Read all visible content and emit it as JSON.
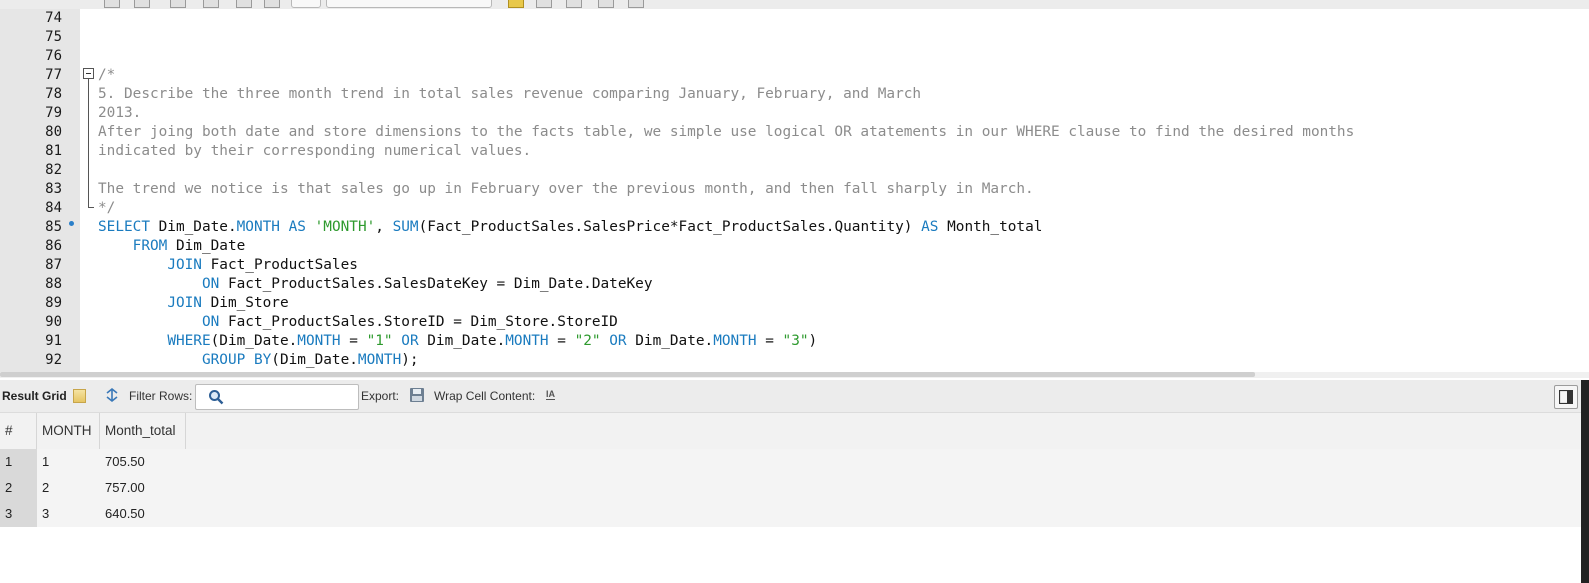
{
  "editor": {
    "lines": [
      {
        "num": "74",
        "segments": []
      },
      {
        "num": "75",
        "segments": []
      },
      {
        "num": "76",
        "segments": []
      },
      {
        "num": "77",
        "segments": [
          {
            "t": "cm",
            "v": "/*"
          }
        ]
      },
      {
        "num": "78",
        "segments": [
          {
            "t": "cm",
            "v": "5. Describe the three month trend in total sales revenue comparing January, February, and March"
          }
        ]
      },
      {
        "num": "79",
        "segments": [
          {
            "t": "cm",
            "v": "2013."
          }
        ]
      },
      {
        "num": "80",
        "segments": [
          {
            "t": "cm",
            "v": "After joing both date and store dimensions to the facts table, we simple use logical OR atatements in our WHERE clause to find the desired months"
          }
        ]
      },
      {
        "num": "81",
        "segments": [
          {
            "t": "cm",
            "v": "indicated by their corresponding numerical values."
          }
        ]
      },
      {
        "num": "82",
        "segments": []
      },
      {
        "num": "83",
        "segments": [
          {
            "t": "cm",
            "v": "The trend we notice is that sales go up in February over the previous month, and then fall sharply in March."
          }
        ]
      },
      {
        "num": "84",
        "segments": [
          {
            "t": "cm",
            "v": "*/"
          }
        ]
      },
      {
        "num": "85",
        "segments": [
          {
            "t": "kw",
            "v": "SELECT"
          },
          {
            "t": "n",
            "v": " Dim_Date."
          },
          {
            "t": "kw",
            "v": "MONTH"
          },
          {
            "t": "n",
            "v": " "
          },
          {
            "t": "kw",
            "v": "AS"
          },
          {
            "t": "n",
            "v": " "
          },
          {
            "t": "str",
            "v": "'MONTH'"
          },
          {
            "t": "n",
            "v": ", "
          },
          {
            "t": "kw",
            "v": "SUM"
          },
          {
            "t": "n",
            "v": "(Fact_ProductSales.SalesPrice*Fact_ProductSales.Quantity) "
          },
          {
            "t": "kw",
            "v": "AS"
          },
          {
            "t": "n",
            "v": " Month_total"
          }
        ]
      },
      {
        "num": "86",
        "segments": [
          {
            "t": "n",
            "v": "    "
          },
          {
            "t": "kw",
            "v": "FROM"
          },
          {
            "t": "n",
            "v": " Dim_Date"
          }
        ]
      },
      {
        "num": "87",
        "segments": [
          {
            "t": "n",
            "v": "        "
          },
          {
            "t": "kw",
            "v": "JOIN"
          },
          {
            "t": "n",
            "v": " Fact_ProductSales"
          }
        ]
      },
      {
        "num": "88",
        "segments": [
          {
            "t": "n",
            "v": "            "
          },
          {
            "t": "kw",
            "v": "ON"
          },
          {
            "t": "n",
            "v": " Fact_ProductSales.SalesDateKey = Dim_Date.DateKey"
          }
        ]
      },
      {
        "num": "89",
        "segments": [
          {
            "t": "n",
            "v": "        "
          },
          {
            "t": "kw",
            "v": "JOIN"
          },
          {
            "t": "n",
            "v": " Dim_Store"
          }
        ]
      },
      {
        "num": "90",
        "segments": [
          {
            "t": "n",
            "v": "            "
          },
          {
            "t": "kw",
            "v": "ON"
          },
          {
            "t": "n",
            "v": " Fact_ProductSales.StoreID = Dim_Store.StoreID"
          }
        ]
      },
      {
        "num": "91",
        "segments": [
          {
            "t": "n",
            "v": "        "
          },
          {
            "t": "kw",
            "v": "WHERE"
          },
          {
            "t": "n",
            "v": "(Dim_Date."
          },
          {
            "t": "kw",
            "v": "MONTH"
          },
          {
            "t": "n",
            "v": " = "
          },
          {
            "t": "str",
            "v": "\"1\""
          },
          {
            "t": "n",
            "v": " "
          },
          {
            "t": "kw",
            "v": "OR"
          },
          {
            "t": "n",
            "v": " Dim_Date."
          },
          {
            "t": "kw",
            "v": "MONTH"
          },
          {
            "t": "n",
            "v": " = "
          },
          {
            "t": "str",
            "v": "\"2\""
          },
          {
            "t": "n",
            "v": " "
          },
          {
            "t": "kw",
            "v": "OR"
          },
          {
            "t": "n",
            "v": " Dim_Date."
          },
          {
            "t": "kw",
            "v": "MONTH"
          },
          {
            "t": "n",
            "v": " = "
          },
          {
            "t": "str",
            "v": "\"3\""
          },
          {
            "t": "n",
            "v": ")"
          }
        ]
      },
      {
        "num": "92",
        "segments": [
          {
            "t": "n",
            "v": "            "
          },
          {
            "t": "kw",
            "v": "GROUP BY"
          },
          {
            "t": "n",
            "v": "(Dim_Date."
          },
          {
            "t": "kw",
            "v": "MONTH"
          },
          {
            "t": "n",
            "v": ");"
          }
        ]
      }
    ]
  },
  "result_toolbar": {
    "result_grid_label": "Result Grid",
    "filter_label": "Filter Rows:",
    "search_value": "",
    "export_label": "Export:",
    "wrap_label": "Wrap Cell Content:",
    "wrap_icon_text": "IA"
  },
  "grid": {
    "columns": [
      "#",
      "MONTH",
      "Month_total"
    ],
    "rows": [
      [
        "1",
        "1",
        "705.50"
      ],
      [
        "2",
        "2",
        "757.00"
      ],
      [
        "3",
        "3",
        "640.50"
      ]
    ]
  },
  "colors": {
    "comment": "#8c8c8c",
    "keyword": "#1a7bbf",
    "string": "#2e9a2e",
    "gutter": "#e6e6e6"
  },
  "icons": [
    "grid-icon",
    "filter-icon",
    "search-icon",
    "export-icon",
    "wrap-icon",
    "panel-toggle-icon",
    "fold-icon",
    "execution-marker-icon"
  ]
}
